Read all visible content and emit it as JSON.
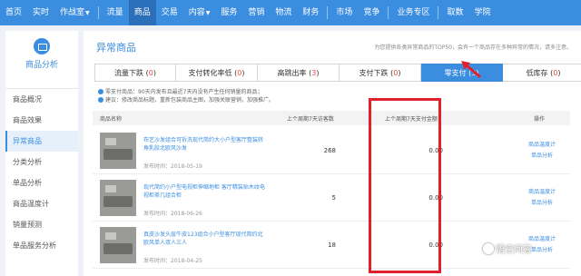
{
  "topnav": {
    "items": [
      "首页",
      "实时",
      "作战室",
      "流量",
      "商品",
      "交易",
      "内容",
      "服务",
      "营销",
      "物流",
      "财务",
      "市场",
      "竞争",
      "业务专区",
      "取数",
      "学院"
    ],
    "active_index": 4
  },
  "sidebar": {
    "title": "商品分析",
    "items": [
      "商品概况",
      "商品效果",
      "异常商品",
      "分类分析",
      "单品分析",
      "商品温度计",
      "销量预测",
      "单品服务分析"
    ],
    "active_index": 2
  },
  "main": {
    "title": "异常商品",
    "description": "为您提供各类异常商品的TOP50，会有一个商品存在多种异常的情况，请多注意。",
    "tabs": [
      {
        "label": "流量下跌",
        "count": "0"
      },
      {
        "label": "支付转化率低",
        "count": "0"
      },
      {
        "label": "高跳出率",
        "count": "3"
      },
      {
        "label": "支付下跌",
        "count": "0"
      },
      {
        "label": "零支付",
        "count": "3"
      },
      {
        "label": "低库存",
        "count": "0"
      }
    ],
    "active_tab": 4,
    "notes": [
      "零支付商品：90天内发布且最近7天内没有产生任何销量的商品；",
      "建议：修改商品标题，重新包装商品主图，加强关联营销，加强推广。"
    ],
    "table": {
      "headers": {
        "name": "商品名称",
        "visits": "上个周期7天访客数",
        "amount": "上个周期7天支付金额",
        "op": "操作"
      },
      "rows": [
        {
          "name": "布艺沙发组合可拆洗现代简约大小户型客厅整装转角乳胶北欧风沙发",
          "time": "发布时间：2018-05-19",
          "visits": "268",
          "amount": "0.00",
          "op1": "商品温度计",
          "op2": "单品分析"
        },
        {
          "name": "现代简约小户型电视柜伸缩地柜 客厅精装贴木纹电视柜茶几组合柜",
          "time": "发布时间：2018-06-26",
          "visits": "5",
          "amount": "0.00",
          "op1": "商品温度计",
          "op2": "单品分析"
        },
        {
          "name": "真皮沙发头层牛皮123组合小户型客厅现代简约北欧风单人双人三人",
          "time": "发布时间：2018-04-25",
          "visits": "18",
          "amount": "0.00",
          "op1": "商品温度计",
          "op2": "单品分析"
        }
      ]
    }
  },
  "watermark": "悟空问答"
}
